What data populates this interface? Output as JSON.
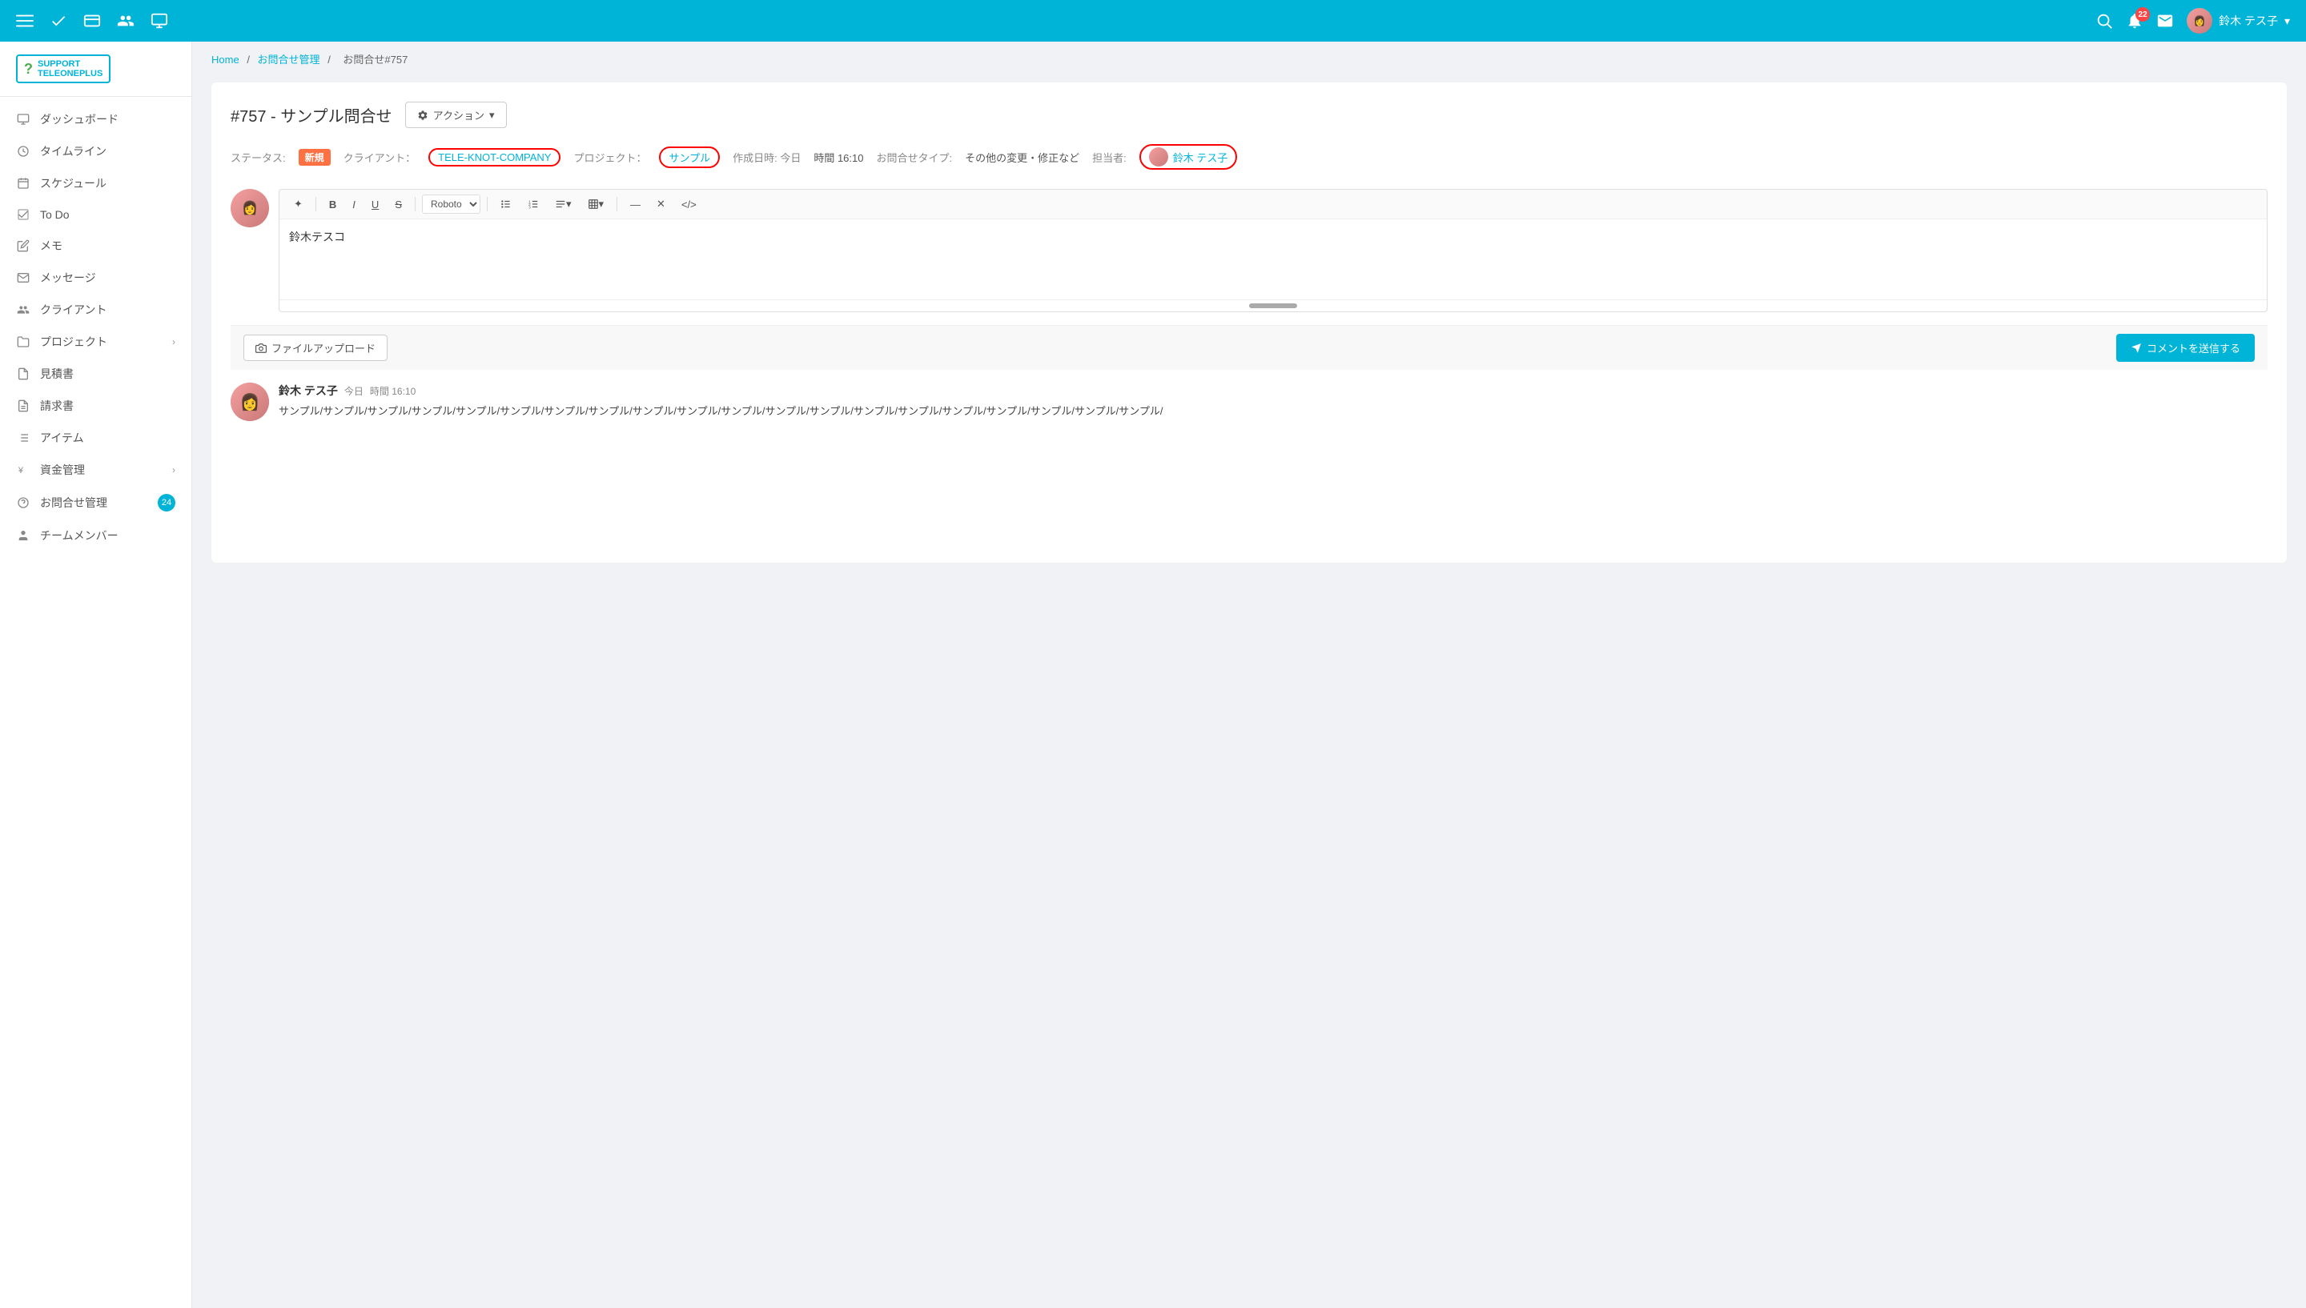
{
  "logo": {
    "icon": "?",
    "line1": "SUPPORT",
    "line2": "TELEONEPLUS"
  },
  "topnav": {
    "notification_count": "22",
    "user_name": "鈴木 テス子"
  },
  "sidebar": {
    "items": [
      {
        "id": "dashboard",
        "label": "ダッシュボード",
        "icon": "monitor"
      },
      {
        "id": "timeline",
        "label": "タイムライン",
        "icon": "clock"
      },
      {
        "id": "schedule",
        "label": "スケジュール",
        "icon": "calendar"
      },
      {
        "id": "todo",
        "label": "To Do",
        "icon": "check"
      },
      {
        "id": "memo",
        "label": "メモ",
        "icon": "edit"
      },
      {
        "id": "messages",
        "label": "メッセージ",
        "icon": "mail"
      },
      {
        "id": "clients",
        "label": "クライアント",
        "icon": "users"
      },
      {
        "id": "projects",
        "label": "プロジェクト",
        "icon": "folder",
        "arrow": true
      },
      {
        "id": "quotes",
        "label": "見積書",
        "icon": "file"
      },
      {
        "id": "invoices",
        "label": "請求書",
        "icon": "file-text"
      },
      {
        "id": "items",
        "label": "アイテム",
        "icon": "list"
      },
      {
        "id": "finance",
        "label": "資金管理",
        "icon": "yen",
        "arrow": true
      },
      {
        "id": "support",
        "label": "お問合せ管理",
        "icon": "help",
        "badge": "24"
      },
      {
        "id": "team",
        "label": "チームメンバー",
        "icon": "user"
      }
    ]
  },
  "breadcrumb": {
    "home": "Home",
    "management": "お問合せ管理",
    "current": "お問合せ#757"
  },
  "ticket": {
    "title": "#757 - サンプル問合せ",
    "action_label": "アクション",
    "status_label": "ステータス:",
    "status_value": "新規",
    "client_label": "クライアント：",
    "client_value": "TELE-KNOT-COMPANY",
    "project_label": "プロジェクト：",
    "project_value": "サンプル",
    "created_label": "作成日時: 今日",
    "created_time": "時間 16:10",
    "type_label": "お問合せタイプ:",
    "type_value": "その他の変更・修正など",
    "assignee_label": "担当者:",
    "assignee_name": "鈴木 テス子"
  },
  "editor": {
    "content": "鈴木テスコ",
    "font_select": "Roboto",
    "toolbar": {
      "ai": "✦",
      "bold": "B",
      "italic": "I",
      "underline": "U",
      "strikethrough": "S",
      "unordered_list": "≡",
      "ordered_list": "≡",
      "align": "≡",
      "table": "⊞",
      "hr": "—",
      "clear": "✕",
      "code": "</>"
    }
  },
  "footer": {
    "upload_label": "ファイルアップロード",
    "send_label": "コメントを送信する"
  },
  "comment": {
    "author": "鈴木 テス子",
    "time_label": "今日",
    "time_value": "時間 16:10",
    "text": "サンプル/サンプル/サンプル/サンプル/サンプル/サンプル/サンプル/サンプル/サンプル/サンプル/サンプル/サンプル/サンプル/サンプル/サンプル/サンプル/サンプル/サンプル/サンプル/サンプル/"
  }
}
